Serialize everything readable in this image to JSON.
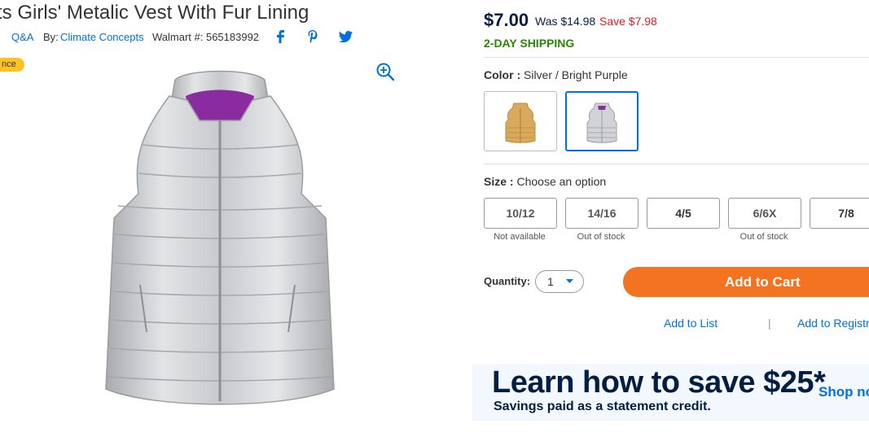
{
  "product": {
    "title": "ts Girls' Metalic Vest With Fur Lining",
    "qa": "Q&A",
    "by_label": "By:",
    "brand": "Climate Concepts",
    "walmart_no": "Walmart #: 565183992",
    "badge": "nce"
  },
  "pricing": {
    "price": "$7.00",
    "was": "Was $14.98",
    "save": "Save $7.98",
    "shipping": "2-DAY SHIPPING"
  },
  "color": {
    "label": "Color :",
    "value": "Silver / Bright Purple"
  },
  "size": {
    "label": "Size :",
    "value": "Choose an option",
    "options": [
      {
        "label": "10/12",
        "note": "Not available"
      },
      {
        "label": "14/16",
        "note": "Out of stock"
      },
      {
        "label": "4/5",
        "note": ""
      },
      {
        "label": "6/6X",
        "note": "Out of stock"
      },
      {
        "label": "7/8",
        "note": ""
      }
    ]
  },
  "quantity": {
    "label": "Quantity:",
    "value": "1"
  },
  "actions": {
    "add_to_cart": "Add to Cart",
    "add_to_list": "Add to List",
    "separator": "|",
    "add_to_registry": "Add to Registr"
  },
  "promo": {
    "headline": "Learn how to save $25*",
    "sub": "Savings paid as a statement credit.",
    "shop": "Shop no"
  },
  "colors": {
    "link": "#0071dc",
    "cart": "#f47321",
    "save": "#de1c24",
    "shipping": "#2a8703",
    "navy": "#041e42"
  }
}
